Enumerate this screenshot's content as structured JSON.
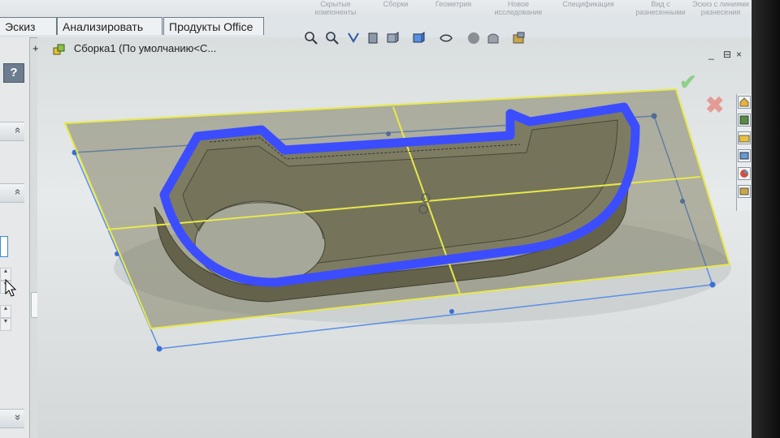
{
  "ribbon": {
    "commands": [
      "Скрытые компоненты",
      "Сборки",
      "Геометрия",
      "Новое исследование движения",
      "Спецификация",
      "Вид с разнесенными частями",
      "Эскиз с линиями разнесения"
    ]
  },
  "tabs": [
    {
      "label": "Эскиз"
    },
    {
      "label": "Анализировать"
    },
    {
      "label": "Продукты Office"
    }
  ],
  "tree": {
    "expand": "+",
    "label": "Сборка1  (По умолчанию<С..."
  },
  "left_panel": {
    "help": "?",
    "collapse_glyph": "»",
    "sections": [
      "«",
      "«"
    ]
  },
  "window_controls": [
    "_",
    "⊟",
    "×"
  ],
  "accept_glyph": "✔",
  "cancel_glyph": "✖",
  "colors": {
    "plane_outline": "#e8e84a",
    "plane_fill": "#6c6a4a",
    "contour": "#3c4dff",
    "part_body": "#8b8a7a",
    "bbox_lines": "#5a8fe6"
  },
  "icons": [
    "zoom-to-fit-icon",
    "zoom-area-icon",
    "previous-view-icon",
    "section-view-icon",
    "view-orientation-icon",
    "display-style-icon",
    "hide-show-icon",
    "edit-appearance-icon",
    "apply-scene-icon",
    "view-settings-icon"
  ]
}
